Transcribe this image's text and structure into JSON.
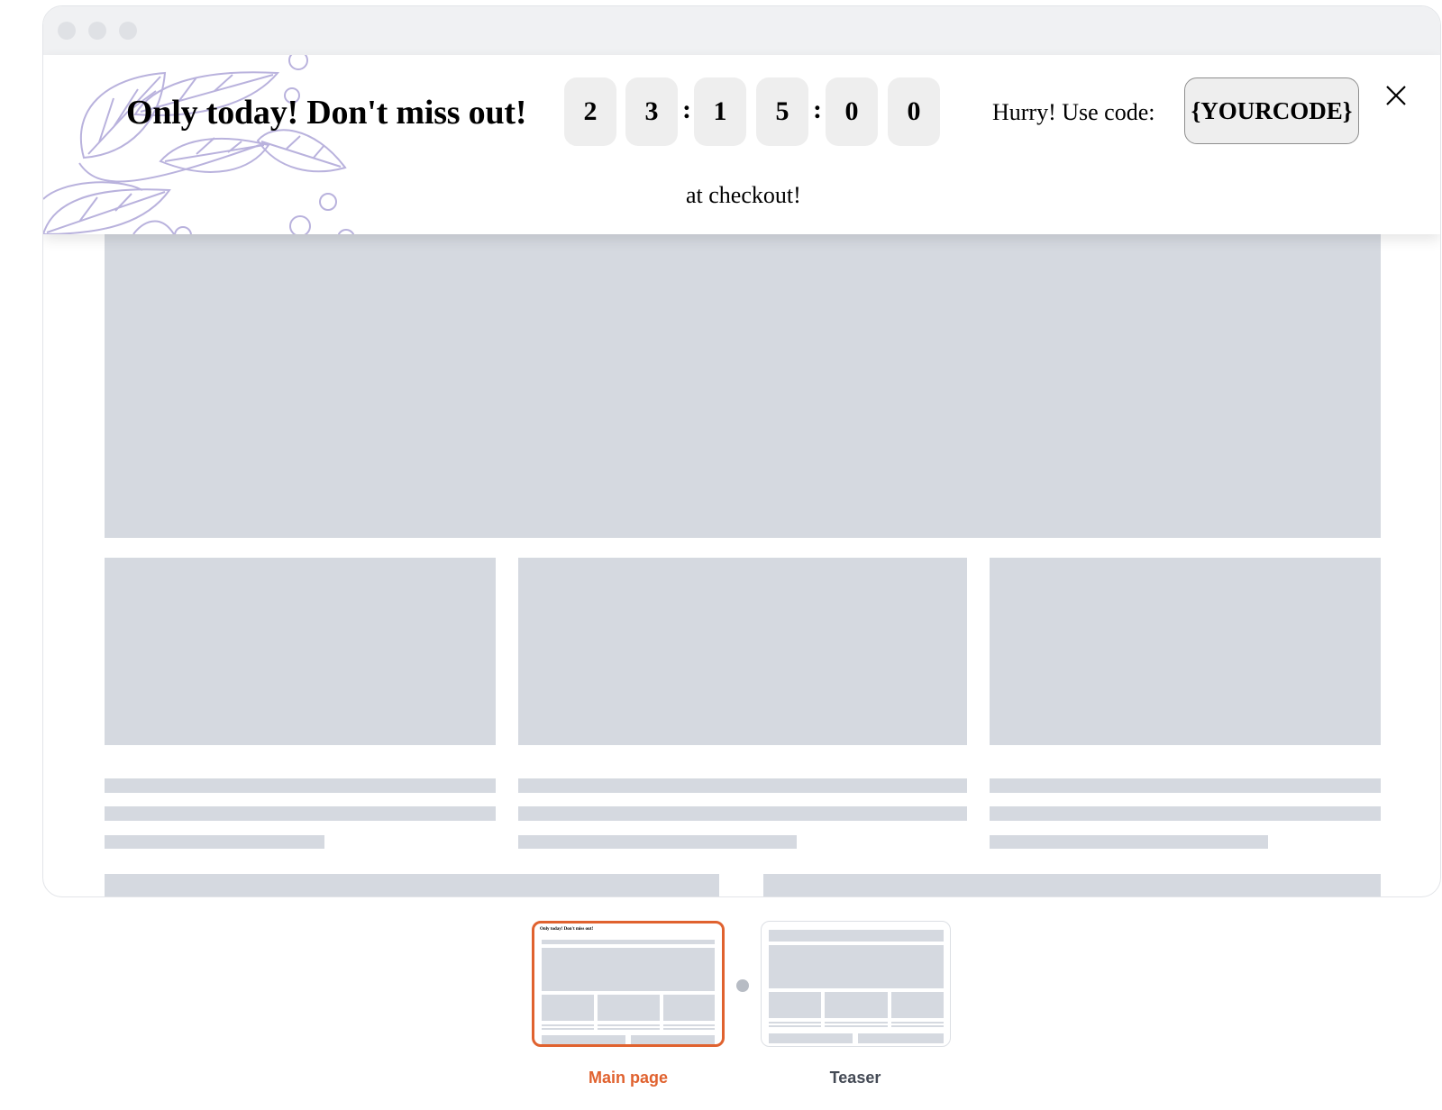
{
  "banner": {
    "headline": "Only today! Don't miss out!",
    "countdown": {
      "hours": [
        "2",
        "3"
      ],
      "minutes": [
        "1",
        "5"
      ],
      "seconds": [
        "0",
        "0"
      ],
      "separator": ":"
    },
    "code_prefix": "Hurry! Use code:",
    "code": "{YOURCODE}",
    "code_suffix": "at checkout!",
    "close_icon": "close-icon"
  },
  "thumbnails": [
    {
      "label": "Main page",
      "selected": true
    },
    {
      "label": "Teaser",
      "selected": false
    }
  ],
  "colors": {
    "accent": "#e0622f",
    "skeleton": "#d5d9e0",
    "digit_bg": "#eeeeee",
    "decor_stroke": "#b9b2dd"
  }
}
